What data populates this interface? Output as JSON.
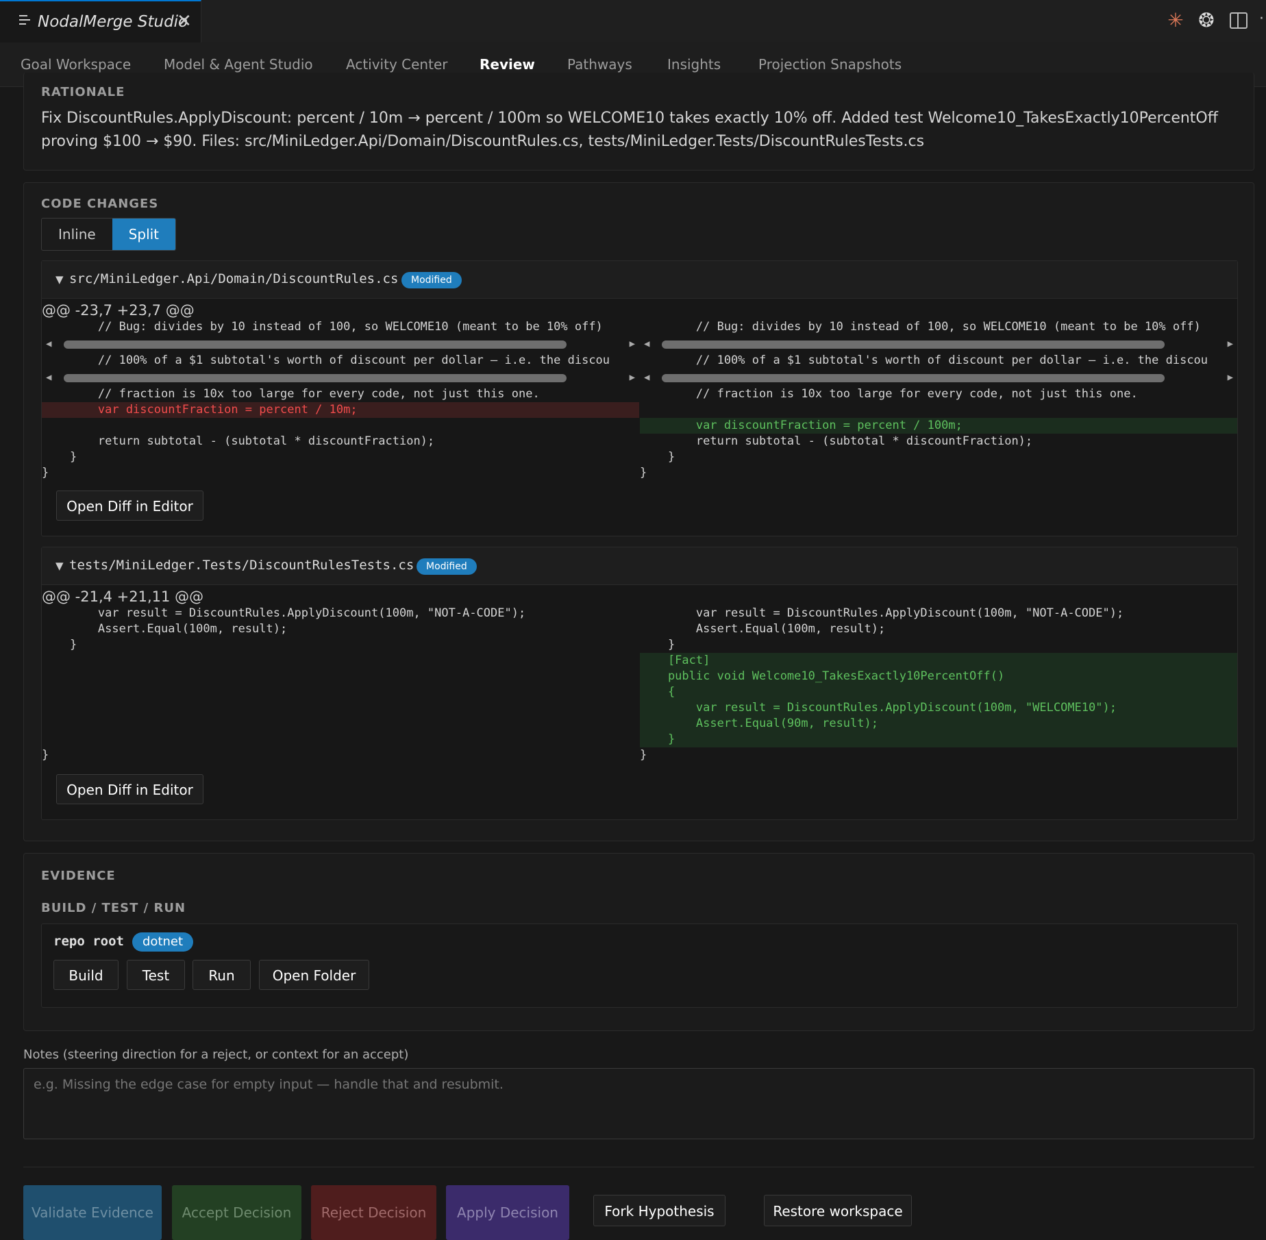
{
  "window": {
    "tab_title": "NodalMerge Studio",
    "close_glyph": "✕",
    "icons": [
      "menu-icon",
      "close-icon",
      "claude-sparkle-icon",
      "openai-icon",
      "panel-toggle-icon",
      "more-icon"
    ],
    "more_glyph": "·"
  },
  "nav": {
    "items": [
      "Goal Workspace",
      "Model & Agent Studio",
      "Activity Center",
      "Review",
      "Pathways",
      "Insights",
      "Projection Snapshots"
    ],
    "active": "Review"
  },
  "rationale": {
    "heading": "RATIONALE",
    "text": "Fix DiscountRules.ApplyDiscount: percent / 10m → percent / 100m so WELCOME10 takes exactly 10% off. Added test Welcome10_TakesExactly10PercentOff proving $100 → $90. Files: src/MiniLedger.Api/Domain/DiscountRules.cs, tests/MiniLedger.Tests/DiscountRulesTests.cs"
  },
  "code_changes": {
    "heading": "CODE CHANGES",
    "view_modes": [
      "Inline",
      "Split"
    ],
    "active_view": "Split",
    "open_diff_label": "Open Diff in Editor",
    "files": [
      {
        "path": "src/MiniLedger.Api/Domain/DiscountRules.cs",
        "status": "Modified",
        "hunk": "@@ -23,7 +23,7 @@",
        "left": [
          "        // Bug: divides by 10 instead of 100, so WELCOME10 (meant to be 10% off)",
          "",
          "        // 100% of a $1 subtotal's worth of discount per dollar — i.e. the discou",
          "",
          "        // fraction is 10x too large for every code, not just this one.",
          "        var discountFraction = percent / 10m;",
          "",
          "        return subtotal - (subtotal * discountFraction);",
          "    }",
          "}"
        ],
        "right": [
          "        // Bug: divides by 10 instead of 100, so WELCOME10 (meant to be 10% off)",
          "",
          "        // 100% of a $1 subtotal's worth of discount per dollar — i.e. the discou",
          "",
          "        // fraction is 10x too large for every code, not just this one.",
          "",
          "        var discountFraction = percent / 100m;",
          "        return subtotal - (subtotal * discountFraction);",
          "    }",
          "}"
        ]
      },
      {
        "path": "tests/MiniLedger.Tests/DiscountRulesTests.cs",
        "status": "Modified",
        "hunk": "@@ -21,4 +21,11 @@",
        "left": [
          "        var result = DiscountRules.ApplyDiscount(100m, \"NOT-A-CODE\");",
          "        Assert.Equal(100m, result);",
          "    }",
          "}"
        ],
        "right": [
          "        var result = DiscountRules.ApplyDiscount(100m, \"NOT-A-CODE\");",
          "        Assert.Equal(100m, result);",
          "    }",
          "    [Fact]",
          "    public void Welcome10_TakesExactly10PercentOff()",
          "    {",
          "        var result = DiscountRules.ApplyDiscount(100m, \"WELCOME10\");",
          "        Assert.Equal(90m, result);",
          "    }",
          "}"
        ]
      }
    ]
  },
  "evidence": {
    "heading": "EVIDENCE",
    "subheading": "BUILD / TEST / RUN",
    "repo_label": "repo root",
    "tool_badge": "dotnet",
    "buttons": [
      "Build",
      "Test",
      "Run",
      "Open Folder"
    ]
  },
  "notes": {
    "label": "Notes (steering direction for a reject, or context for an accept)",
    "placeholder": "e.g. Missing the edge case for empty input — handle that and resubmit.",
    "value": ""
  },
  "actions": {
    "validate": "Validate Evidence",
    "accept": "Accept Decision",
    "reject": "Reject Decision",
    "apply": "Apply Decision",
    "fork": "Fork Hypothesis",
    "restore": "Restore workspace"
  },
  "colors": {
    "accent": "#1f7dbc",
    "deleted_text": "#f14c4c",
    "added_text": "#5ec05e",
    "background": "#181818"
  }
}
